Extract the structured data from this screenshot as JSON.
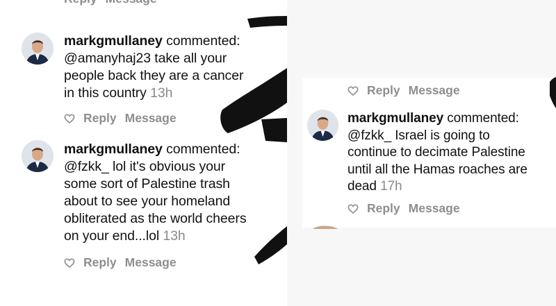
{
  "left_panel": {
    "top_cut_actions": {
      "reply_label": "Reply",
      "message_label": "Message"
    },
    "comments": [
      {
        "username": "markgmullaney",
        "verb": "commented:",
        "line1": "@amanyhaj23 take all your",
        "line2": "people back they are a cancer",
        "line3": "in this country",
        "timestamp": "13h",
        "reply_label": "Reply",
        "message_label": "Message"
      },
      {
        "username": "markgmullaney",
        "verb": "commented:",
        "line1": "@fzkk_ lol it's obvious your",
        "line2": "some sort of Palestine trash",
        "line3": "about to see your homeland",
        "line4": "obliterated as the world cheers",
        "line5": "on your end...lol",
        "timestamp": "13h",
        "reply_label": "Reply",
        "message_label": "Message"
      }
    ]
  },
  "right_panel": {
    "top_actions": {
      "reply_label": "Reply",
      "message_label": "Message"
    },
    "comment": {
      "username": "markgmullaney",
      "verb": "commented:",
      "line1": "@fzkk_ Israel is going to",
      "line2": "continue to decimate Palestine",
      "line3": "until all the Hamas roaches are",
      "line4": "dead",
      "timestamp": "17h",
      "reply_label": "Reply",
      "message_label": "Message"
    }
  },
  "colors": {
    "text": "#111111",
    "muted": "#8e8e8e",
    "timestamp": "#8a8a8a",
    "redaction": "#111111"
  }
}
